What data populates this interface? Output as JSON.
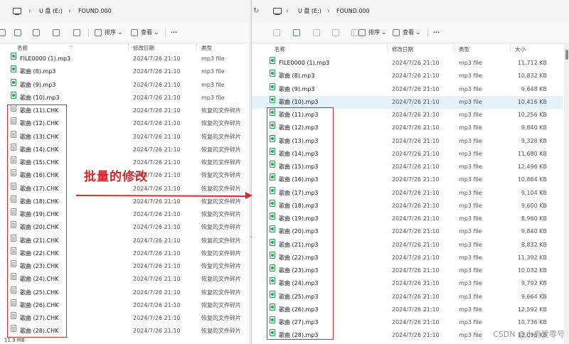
{
  "left": {
    "breadcrumb": [
      "U 盘 (E:)",
      "FOUND.000"
    ],
    "toolbar": {
      "sort": "排序",
      "view": "查看",
      "more": "···"
    },
    "columns": {
      "name": "名称",
      "date": "修改日期",
      "type": "类型"
    },
    "rows": [
      {
        "name": "FILE0000 (1).mp3",
        "date": "2024/7/26 21:10",
        "type": "mp3 file",
        "icon": "mp3"
      },
      {
        "name": "歌曲 (8).mp3",
        "date": "2024/7/26 21:10",
        "type": "mp3 file",
        "icon": "mp3"
      },
      {
        "name": "歌曲 (9).mp3",
        "date": "2024/7/26 21:10",
        "type": "mp3 file",
        "icon": "mp3"
      },
      {
        "name": "歌曲 (10).mp3",
        "date": "2024/7/26 21:10",
        "type": "mp3 file",
        "icon": "mp3"
      },
      {
        "name": "歌曲 (11).CHK",
        "date": "2024/7/26 21:10",
        "type": "恢复的文件碎片",
        "icon": "chk"
      },
      {
        "name": "歌曲 (12).CHK",
        "date": "2024/7/26 21:10",
        "type": "恢复的文件碎片",
        "icon": "chk"
      },
      {
        "name": "歌曲 (13).CHK",
        "date": "2024/7/26 21:10",
        "type": "恢复的文件碎片",
        "icon": "chk"
      },
      {
        "name": "歌曲 (14).CHK",
        "date": "2024/7/26 21:10",
        "type": "恢复的文件碎片",
        "icon": "chk"
      },
      {
        "name": "歌曲 (15).CHK",
        "date": "2024/7/26 21:10",
        "type": "恢复的文件碎片",
        "icon": "chk"
      },
      {
        "name": "歌曲 (16).CHK",
        "date": "2024/7/26 21:10",
        "type": "恢复的文件碎片",
        "icon": "chk"
      },
      {
        "name": "歌曲 (17).CHK",
        "date": "2024/7/26 21:10",
        "type": "恢复的文件碎片",
        "icon": "chk"
      },
      {
        "name": "歌曲 (18).CHK",
        "date": "2024/7/26 21:10",
        "type": "恢复的文件碎片",
        "icon": "chk"
      },
      {
        "name": "歌曲 (19).CHK",
        "date": "2024/7/26 21:10",
        "type": "恢复的文件碎片",
        "icon": "chk"
      },
      {
        "name": "歌曲 (20).CHK",
        "date": "2024/7/26 21:10",
        "type": "恢复的文件碎片",
        "icon": "chk"
      },
      {
        "name": "歌曲 (21).CHK",
        "date": "2024/7/26 21:10",
        "type": "恢复的文件碎片",
        "icon": "chk"
      },
      {
        "name": "歌曲 (22).CHK",
        "date": "2024/7/26 21:10",
        "type": "恢复的文件碎片",
        "icon": "chk"
      },
      {
        "name": "歌曲 (23).CHK",
        "date": "2024/7/26 21:10",
        "type": "恢复的文件碎片",
        "icon": "chk"
      },
      {
        "name": "歌曲 (24).CHK",
        "date": "2024/7/26 21:10",
        "type": "恢复的文件碎片",
        "icon": "chk"
      },
      {
        "name": "歌曲 (25).CHK",
        "date": "2024/7/26 21:10",
        "type": "恢复的文件碎片",
        "icon": "chk"
      },
      {
        "name": "歌曲 (26).CHK",
        "date": "2024/7/26 21:10",
        "type": "恢复的文件碎片",
        "icon": "chk"
      },
      {
        "name": "歌曲 (27).CHK",
        "date": "2024/7/26 21:10",
        "type": "恢复的文件碎片",
        "icon": "chk"
      },
      {
        "name": "歌曲 (28).CHK",
        "date": "2024/7/26 21:10",
        "type": "恢复的文件碎片",
        "icon": "chk"
      }
    ],
    "status": "11.3 MB"
  },
  "right": {
    "breadcrumb": [
      "U 盘 (E:)",
      "FOUND.000"
    ],
    "toolbar": {
      "sort": "排序",
      "view": "查看",
      "more": "···"
    },
    "columns": {
      "name": "名称",
      "date": "修改日期",
      "type": "类型",
      "size": "大小"
    },
    "rows": [
      {
        "name": "FILE0000 (1).mp3",
        "date": "2024/7/26 21:10",
        "type": "mp3 file",
        "size": "11,712 KB"
      },
      {
        "name": "歌曲 (8).mp3",
        "date": "2024/7/26 21:10",
        "type": "mp3 file",
        "size": "10,832 KB"
      },
      {
        "name": "歌曲 (9).mp3",
        "date": "2024/7/26 21:10",
        "type": "mp3 file",
        "size": "9,648 KB"
      },
      {
        "name": "歌曲 (10).mp3",
        "date": "2024/7/26 21:10",
        "type": "mp3 file",
        "size": "10,416 KB"
      },
      {
        "name": "歌曲 (11).mp3",
        "date": "2024/7/26 21:10",
        "type": "mp3 file",
        "size": "10,256 KB"
      },
      {
        "name": "歌曲 (12).mp3",
        "date": "2024/7/26 21:10",
        "type": "mp3 file",
        "size": "9,840 KB"
      },
      {
        "name": "歌曲 (13).mp3",
        "date": "2024/7/26 21:10",
        "type": "mp3 file",
        "size": "9,328 KB"
      },
      {
        "name": "歌曲 (14).mp3",
        "date": "2024/7/26 21:10",
        "type": "mp3 file",
        "size": "11,680 KB"
      },
      {
        "name": "歌曲 (15).mp3",
        "date": "2024/7/26 21:10",
        "type": "mp3 file",
        "size": "12,496 KB"
      },
      {
        "name": "歌曲 (16).mp3",
        "date": "2024/7/26 21:10",
        "type": "mp3 file",
        "size": "10,864 KB"
      },
      {
        "name": "歌曲 (17).mp3",
        "date": "2024/7/26 21:10",
        "type": "mp3 file",
        "size": "9,104 KB"
      },
      {
        "name": "歌曲 (18).mp3",
        "date": "2024/7/26 21:10",
        "type": "mp3 file",
        "size": "9,600 KB"
      },
      {
        "name": "歌曲 (19).mp3",
        "date": "2024/7/26 21:10",
        "type": "mp3 file",
        "size": "8,960 KB"
      },
      {
        "name": "歌曲 (20).mp3",
        "date": "2024/7/26 21:10",
        "type": "mp3 file",
        "size": "9,840 KB"
      },
      {
        "name": "歌曲 (21).mp3",
        "date": "2024/7/26 21:10",
        "type": "mp3 file",
        "size": "8,832 KB"
      },
      {
        "name": "歌曲 (22).mp3",
        "date": "2024/7/26 21:10",
        "type": "mp3 file",
        "size": "11,392 KB"
      },
      {
        "name": "歌曲 (23).mp3",
        "date": "2024/7/26 21:10",
        "type": "mp3 file",
        "size": "10,032 KB"
      },
      {
        "name": "歌曲 (24).mp3",
        "date": "2024/7/26 21:10",
        "type": "mp3 file",
        "size": "9,792 KB"
      },
      {
        "name": "歌曲 (25).mp3",
        "date": "2024/7/26 21:10",
        "type": "mp3 file",
        "size": "9,664 KB"
      },
      {
        "name": "歌曲 (26).mp3",
        "date": "2024/7/26 21:10",
        "type": "mp3 file",
        "size": "12,592 KB"
      },
      {
        "name": "歌曲 (27).mp3",
        "date": "2024/7/26 21:10",
        "type": "mp3 file",
        "size": "10,736 KB"
      },
      {
        "name": "歌曲 (28).mp3",
        "date": "2024/7/26 21:10",
        "type": "mp3 file",
        "size": "12,096 KB"
      }
    ],
    "selected_row": 3
  },
  "annotation": {
    "text": "批量的修改",
    "color": "#e0282e"
  },
  "watermark": "CSDN @小启爱零号",
  "colors": {
    "mp3_icon": "#2f9e5b",
    "selection": "#e5f1fb",
    "annotation_red": "#e0282e"
  }
}
